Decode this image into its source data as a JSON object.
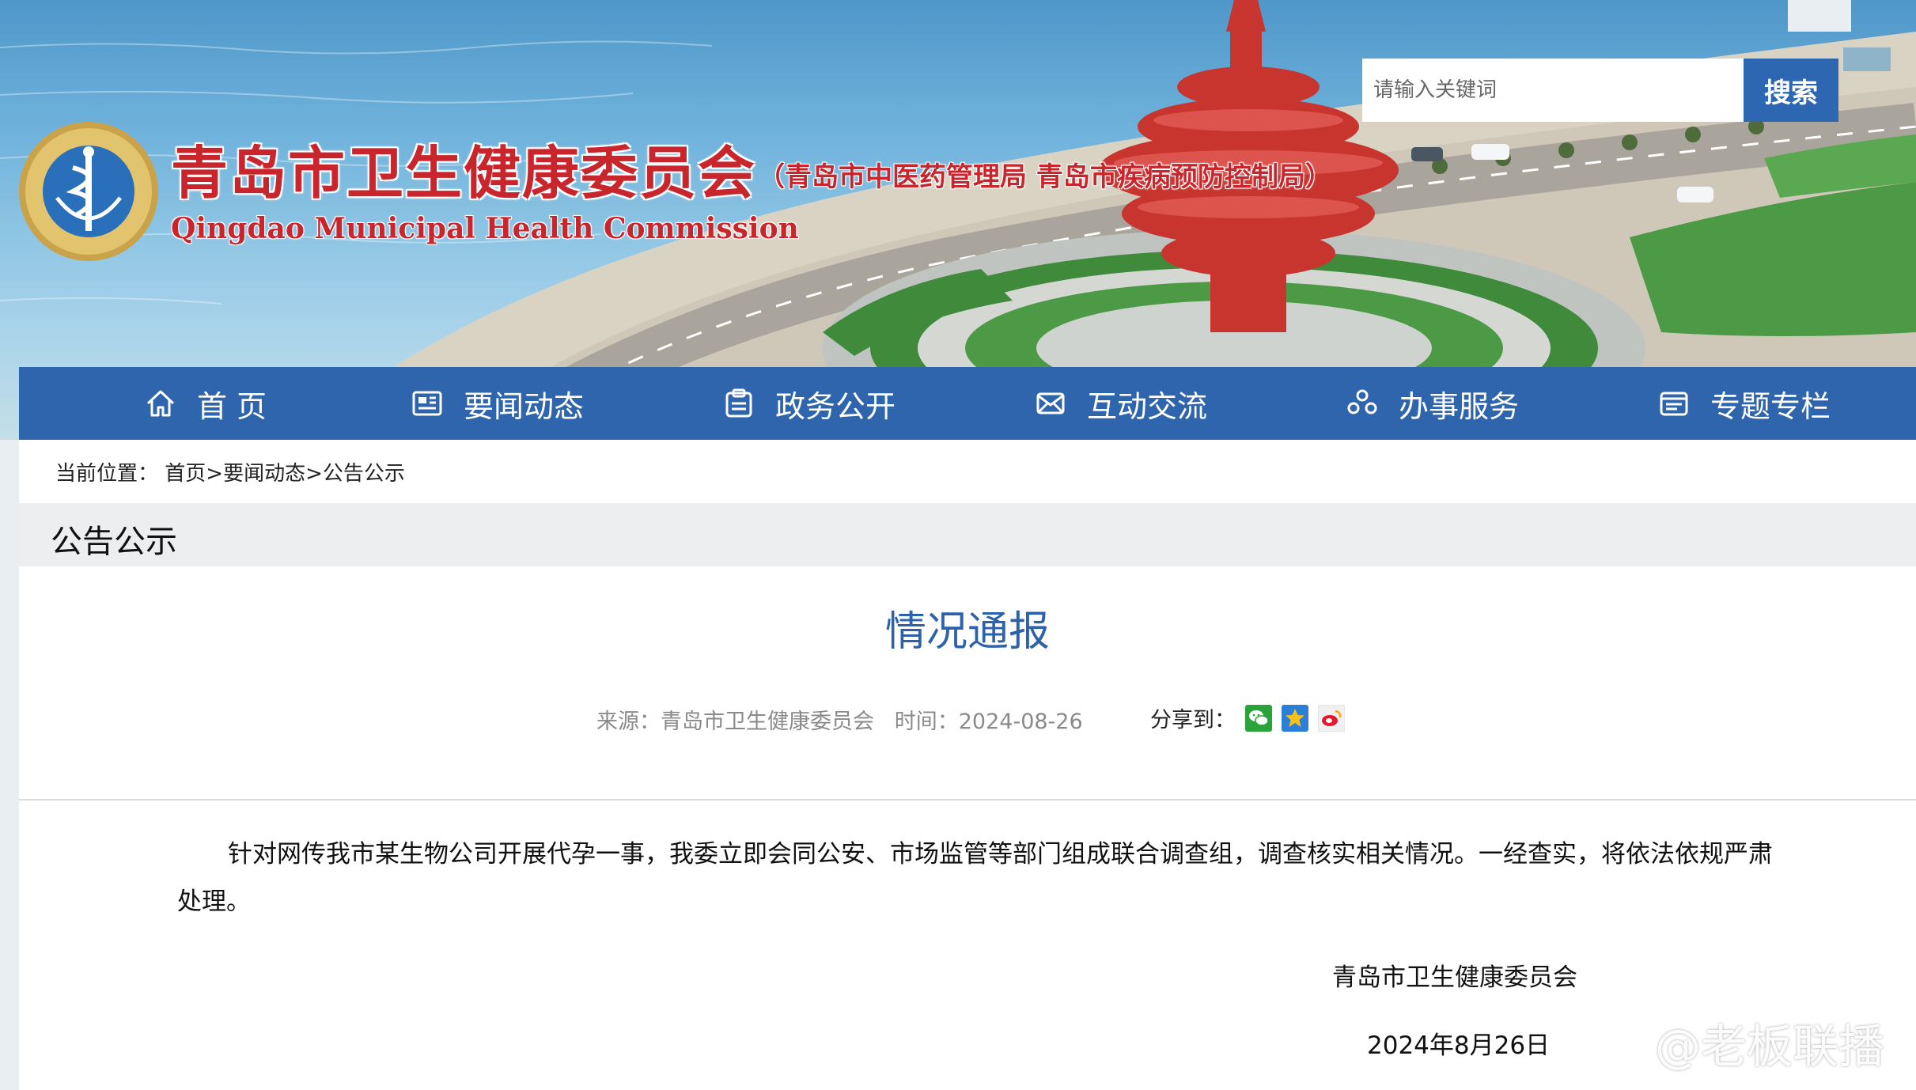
{
  "header": {
    "title": "青岛市卫生健康委员会",
    "subtitle": "（青岛市中医药管理局  青岛市疾病预防控制局）",
    "english_name": "Qingdao Municipal Health Commission",
    "logo_icon": "health-commission-emblem-icon"
  },
  "search": {
    "placeholder": "请输入关键词",
    "button_label": "搜索"
  },
  "nav": {
    "items": [
      {
        "label": "首 页",
        "icon": "home-icon"
      },
      {
        "label": "要闻动态",
        "icon": "newspaper-icon"
      },
      {
        "label": "政务公开",
        "icon": "clipboard-icon"
      },
      {
        "label": "互动交流",
        "icon": "mail-icon"
      },
      {
        "label": "办事服务",
        "icon": "service-icon"
      },
      {
        "label": "专题专栏",
        "icon": "folder-icon"
      }
    ]
  },
  "breadcrumb": {
    "prefix": "当前位置：",
    "items": [
      "首页",
      "要闻动态",
      "公告公示"
    ],
    "separator": ">"
  },
  "section": {
    "title": "公告公示"
  },
  "article": {
    "title": "情况通报",
    "source_label": "来源：",
    "source": "青岛市卫生健康委员会",
    "time_label": "时间：",
    "time": "2024-08-26",
    "share_label": "分享到：",
    "share_icons": [
      "wechat-icon",
      "qzone-icon",
      "weibo-icon"
    ],
    "body": "针对网传我市某生物公司开展代孕一事，我委立即会同公安、市场监管等部门组成联合调查组，调查核实相关情况。一经查实，将依法依规严肃处理。",
    "signature_org": "青岛市卫生健康委员会",
    "signature_date": "2024年8月26日"
  },
  "watermark": {
    "text": "@老板联播",
    "icon": "weibo-logo-icon"
  },
  "colors": {
    "nav_bg": "#2f65ad",
    "title_red": "#c8252c",
    "article_title_blue": "#2b62aa",
    "search_btn": "#2e67b1"
  }
}
